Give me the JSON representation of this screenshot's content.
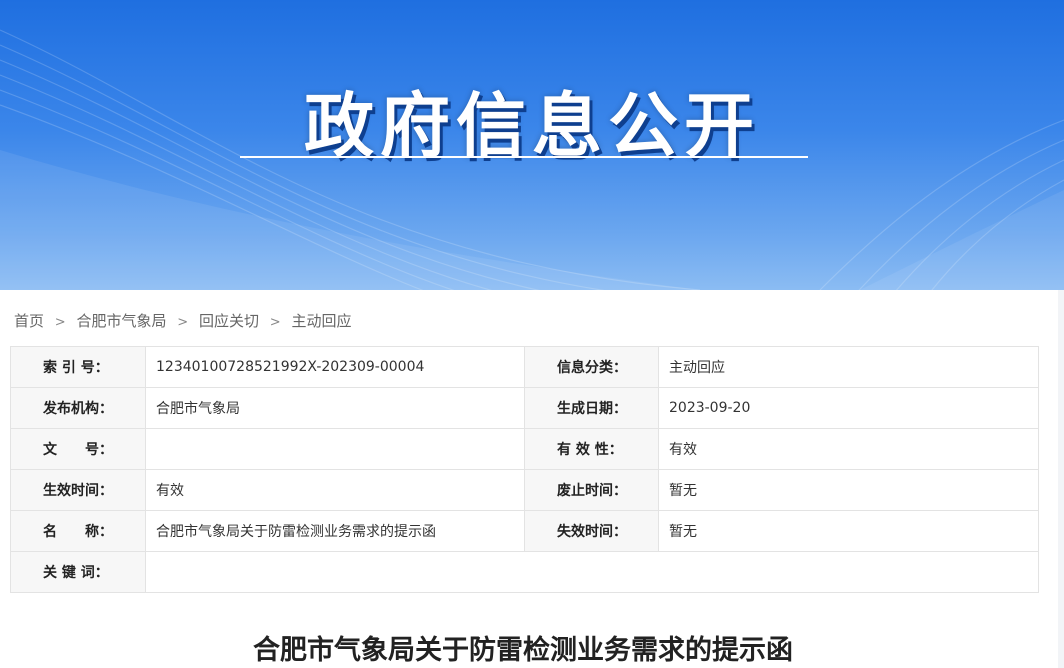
{
  "banner": {
    "title": "政府信息公开"
  },
  "breadcrumb": {
    "items": [
      "首页",
      "合肥市气象局",
      "回应关切",
      "主动回应"
    ],
    "separator": ">"
  },
  "meta": {
    "index_label": "索 引 号：",
    "index_value": "12340100728521992X-202309-00004",
    "category_label": "信息分类：",
    "category_value": "主动回应",
    "publisher_label": "发布机构：",
    "publisher_value": "合肥市气象局",
    "date_label": "生成日期：",
    "date_value": "2023-09-20",
    "docno_label": "文　　号：",
    "docno_value": "",
    "validity_label": "有 效 性：",
    "validity_value": "有效",
    "effective_label": "生效时间：",
    "effective_value": "有效",
    "repeal_label": "废止时间：",
    "repeal_value": "暂无",
    "name_label": "名　　称：",
    "name_value": "合肥市气象局关于防雷检测业务需求的提示函",
    "expiry_label": "失效时间：",
    "expiry_value": "暂无",
    "keywords_label": "关 键 词：",
    "keywords_value": ""
  },
  "document": {
    "title": "合肥市气象局关于防雷检测业务需求的提示函"
  },
  "colors": {
    "banner_top": "#1f6fe0",
    "banner_bottom": "#8bbcf3",
    "title_shadow": "#0e3f8f"
  }
}
